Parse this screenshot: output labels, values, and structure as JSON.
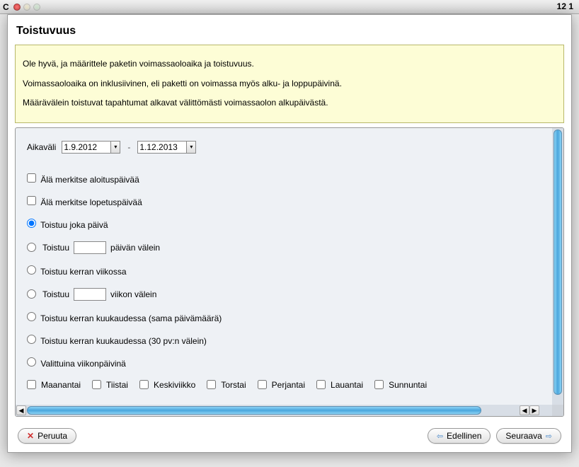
{
  "background": {
    "header_right": "12 1",
    "left_char": "C"
  },
  "dialog": {
    "title": "Toistuvuus",
    "info": {
      "line1": "Ole hyvä, ja määrittele paketin voimassaoloaika ja toistuvuus.",
      "line2": "Voimassaoloaika on inklusiivinen, eli paketti on voimassa myös alku- ja loppupäivinä.",
      "line3": "Määrävälein toistuvat tapahtumat alkavat välittömästi voimassaolon alkupäivästä."
    },
    "range": {
      "label": "Aikaväli",
      "from": "1.9.2012",
      "sep": "-",
      "to": "1.12.2013"
    },
    "checks": {
      "no_start": "Älä merkitse aloituspäivää",
      "no_end": "Älä merkitse lopetuspäivää"
    },
    "radios": {
      "daily": "Toistuu joka päivä",
      "every_n_days_pre": "Toistuu",
      "every_n_days_post": "päivän välein",
      "weekly_once": "Toistuu kerran viikossa",
      "every_n_weeks_pre": "Toistuu",
      "every_n_weeks_post": "viikon välein",
      "monthly_same_day": "Toistuu kerran kuukaudessa (sama päivämäärä)",
      "monthly_30": "Toistuu kerran kuukaudessa (30 pv:n välein)",
      "weekdays": "Valittuina viikonpäivinä"
    },
    "days": {
      "mon": "Maanantai",
      "tue": "Tiistai",
      "wed": "Keskiviikko",
      "thu": "Torstai",
      "fri": "Perjantai",
      "sat": "Lauantai",
      "sun": "Sunnuntai"
    },
    "buttons": {
      "cancel": "Peruuta",
      "prev": "Edellinen",
      "next": "Seuraava"
    }
  }
}
